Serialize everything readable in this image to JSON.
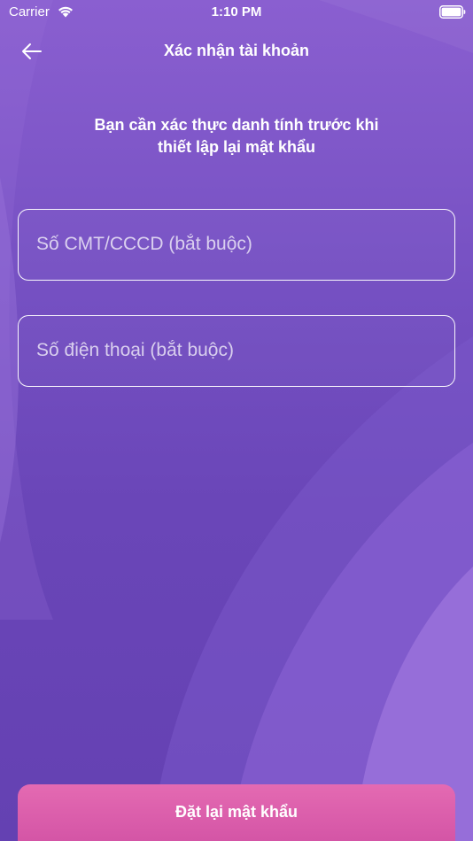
{
  "status_bar": {
    "carrier": "Carrier",
    "time": "1:10 PM",
    "wifi_icon": "wifi-icon",
    "battery_icon": "battery-full-icon"
  },
  "nav": {
    "back_icon": "arrow-left-icon",
    "title": "Xác nhận tài khoản"
  },
  "description": {
    "line1": "Bạn cần xác thực danh tính trước khi",
    "line2": "thiết lập lại mật khẩu"
  },
  "form": {
    "id_number": {
      "value": "",
      "placeholder": "Số CMT/CCCD (bắt buộc)"
    },
    "phone": {
      "value": "",
      "placeholder": "Số điện thoại (bắt buộc)"
    }
  },
  "submit": {
    "label": "Đặt lại mật khẩu"
  },
  "colors": {
    "background_top": "#8a5fd0",
    "background_bottom": "#6441b2",
    "button_pink": "#de60ad",
    "text": "#ffffff"
  }
}
